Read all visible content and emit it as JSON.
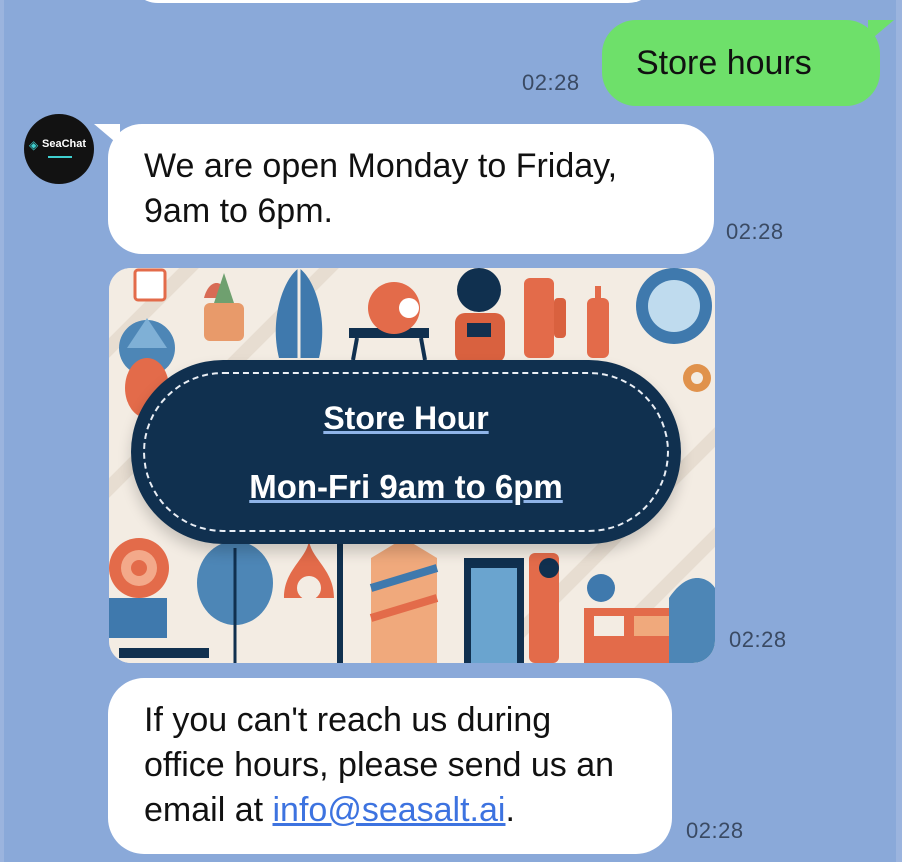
{
  "messages": {
    "user_query": {
      "text": "Store hours",
      "time": "02:28"
    },
    "bot_reply_1": {
      "text": "We are open Monday to Friday, 9am to 6pm.",
      "time": "02:28"
    },
    "bot_image": {
      "title": "Store Hour",
      "subtitle": "Mon-Fri 9am to 6pm",
      "time": "02:28"
    },
    "bot_reply_2": {
      "text_before": "If you can't reach us during office hours, please send us an email at ",
      "email": "info@seasalt.ai",
      "text_after": ".",
      "time": "02:28"
    }
  },
  "bot": {
    "avatar_label": "SeaChat",
    "avatar_icon": "seachat-logo-icon"
  },
  "colors": {
    "background": "#8aa9d9",
    "user_bubble": "#6ee06a",
    "bot_bubble": "#ffffff",
    "link": "#3d73e0",
    "banner": "#10304f"
  }
}
